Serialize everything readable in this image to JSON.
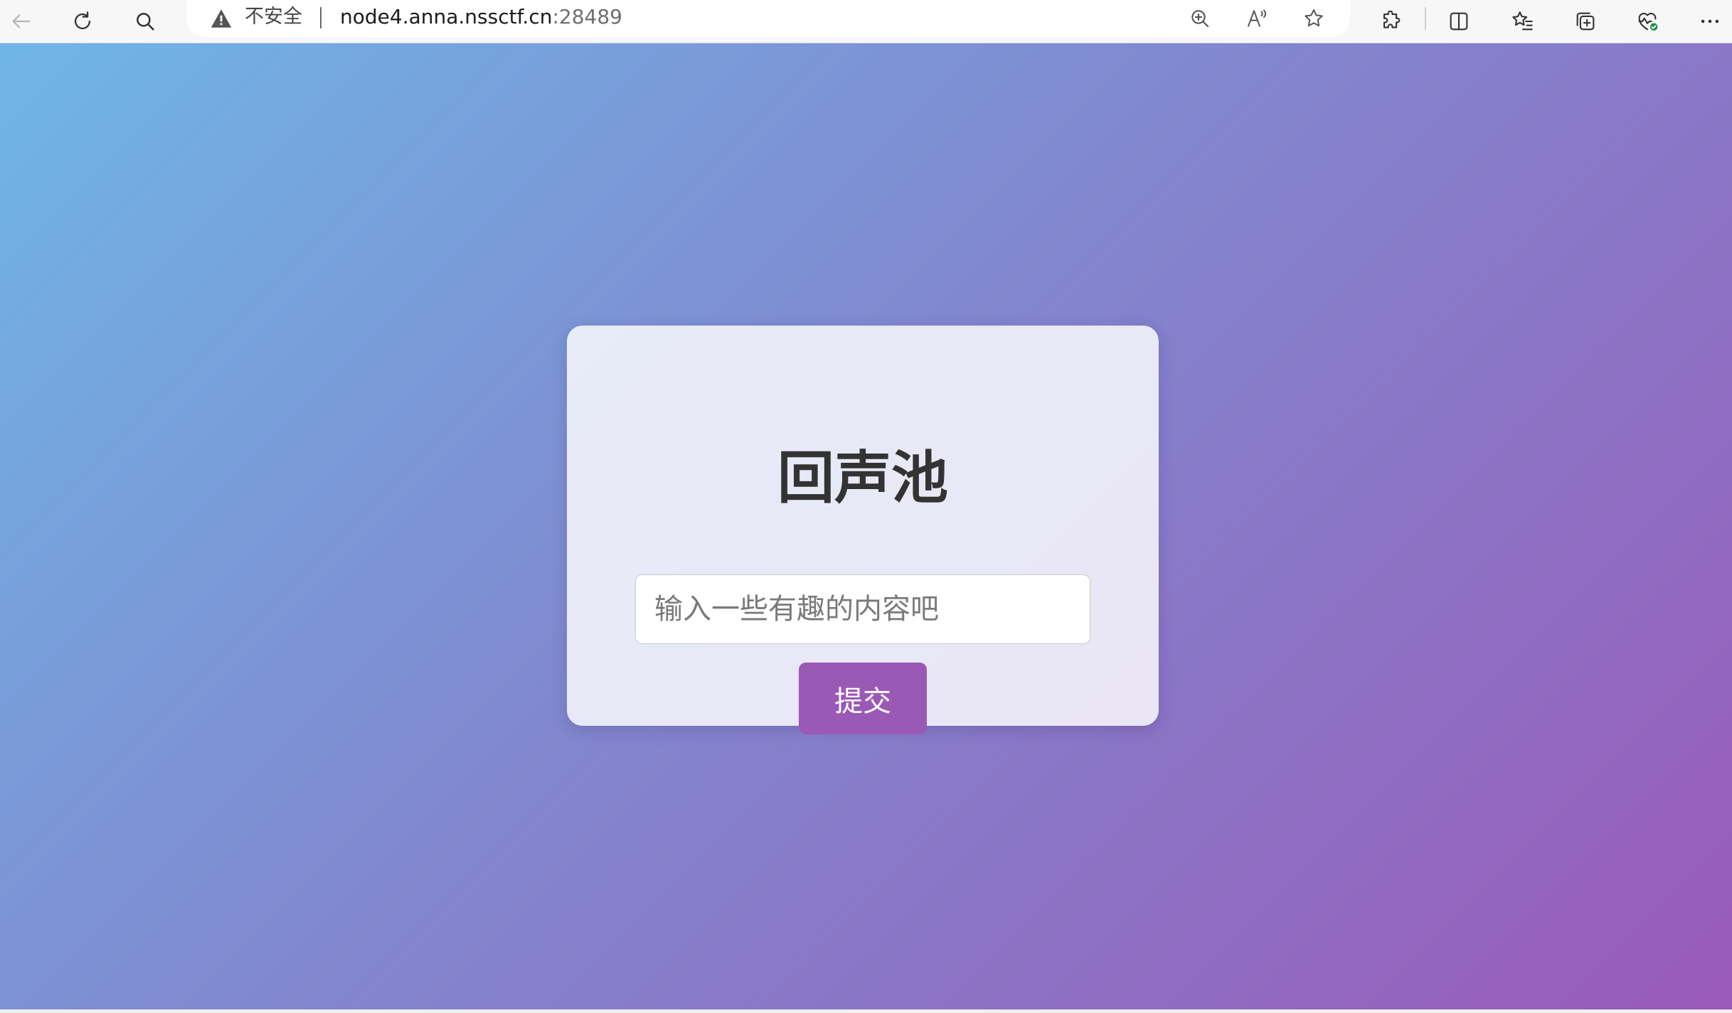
{
  "browser": {
    "address": {
      "security_label": "不安全",
      "host": "node4.anna.nssctf.cn",
      "port": ":28489"
    },
    "toolbar_icons": {
      "back": "back-arrow-icon",
      "refresh": "refresh-icon",
      "search": "search-icon",
      "warning": "warning-triangle-icon",
      "zoom": "zoom-in-icon",
      "read_aloud": "read-aloud-icon",
      "favorite": "star-icon",
      "extensions": "puzzle-icon",
      "split_screen": "split-screen-icon",
      "favorites_list": "favorites-list-icon",
      "collections": "collections-icon",
      "browser_essentials": "heartbeat-icon",
      "more": "more-dots-icon"
    }
  },
  "page": {
    "title": "回声池",
    "input": {
      "placeholder": "输入一些有趣的内容吧",
      "value": ""
    },
    "submit_label": "提交"
  },
  "colors": {
    "gradient_start": "#6fb6e6",
    "gradient_mid": "#8188cf",
    "gradient_end": "#9a5ab9",
    "button": "#9b59b6",
    "title": "#333333"
  }
}
